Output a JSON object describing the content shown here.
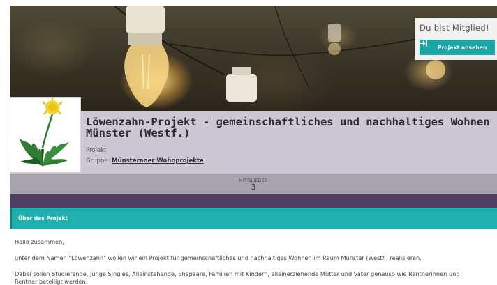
{
  "membership": {
    "status": "Du bist Mitglied!",
    "button_label": "Projekt ansehen",
    "button_icon": "sign-in-icon"
  },
  "project": {
    "title_line1": "Löwenzahn-Projekt - gemeinschaftliches und nachhaltiges Wohnen in",
    "title_line2": "Münster (Westf.)",
    "type": "Projekt",
    "group_prefix": "Gruppe:",
    "group_name": "Münsteraner Wohnprojekte",
    "logo_icon": "dandelion-icon"
  },
  "stats": {
    "members_label": "MITGLIEDER",
    "members_value": "3"
  },
  "about": {
    "heading": "Über das Projekt",
    "paragraphs": [
      "Hallo zusammen,",
      "unter dem Namen \"Löwenzahn\" wollen wir ein Projekt für gemeinschaftliches und nachhaltiges Wohnen im Raum Münster (Westf.) realisieren.",
      "Dabei sollen Studierende, junge Singles, Alleinstehende, Ehepaare, Familien mit Kindern, alleinerziehende Mütter und Väter genauso wie Rentnerinnen und",
      "Rentner beteiligt werden."
    ]
  },
  "colors": {
    "accent_teal": "#21b0ae",
    "title_band": "#cdc7d4",
    "stats_band": "#a8a2ad",
    "purple_bar": "#4e3f61"
  }
}
